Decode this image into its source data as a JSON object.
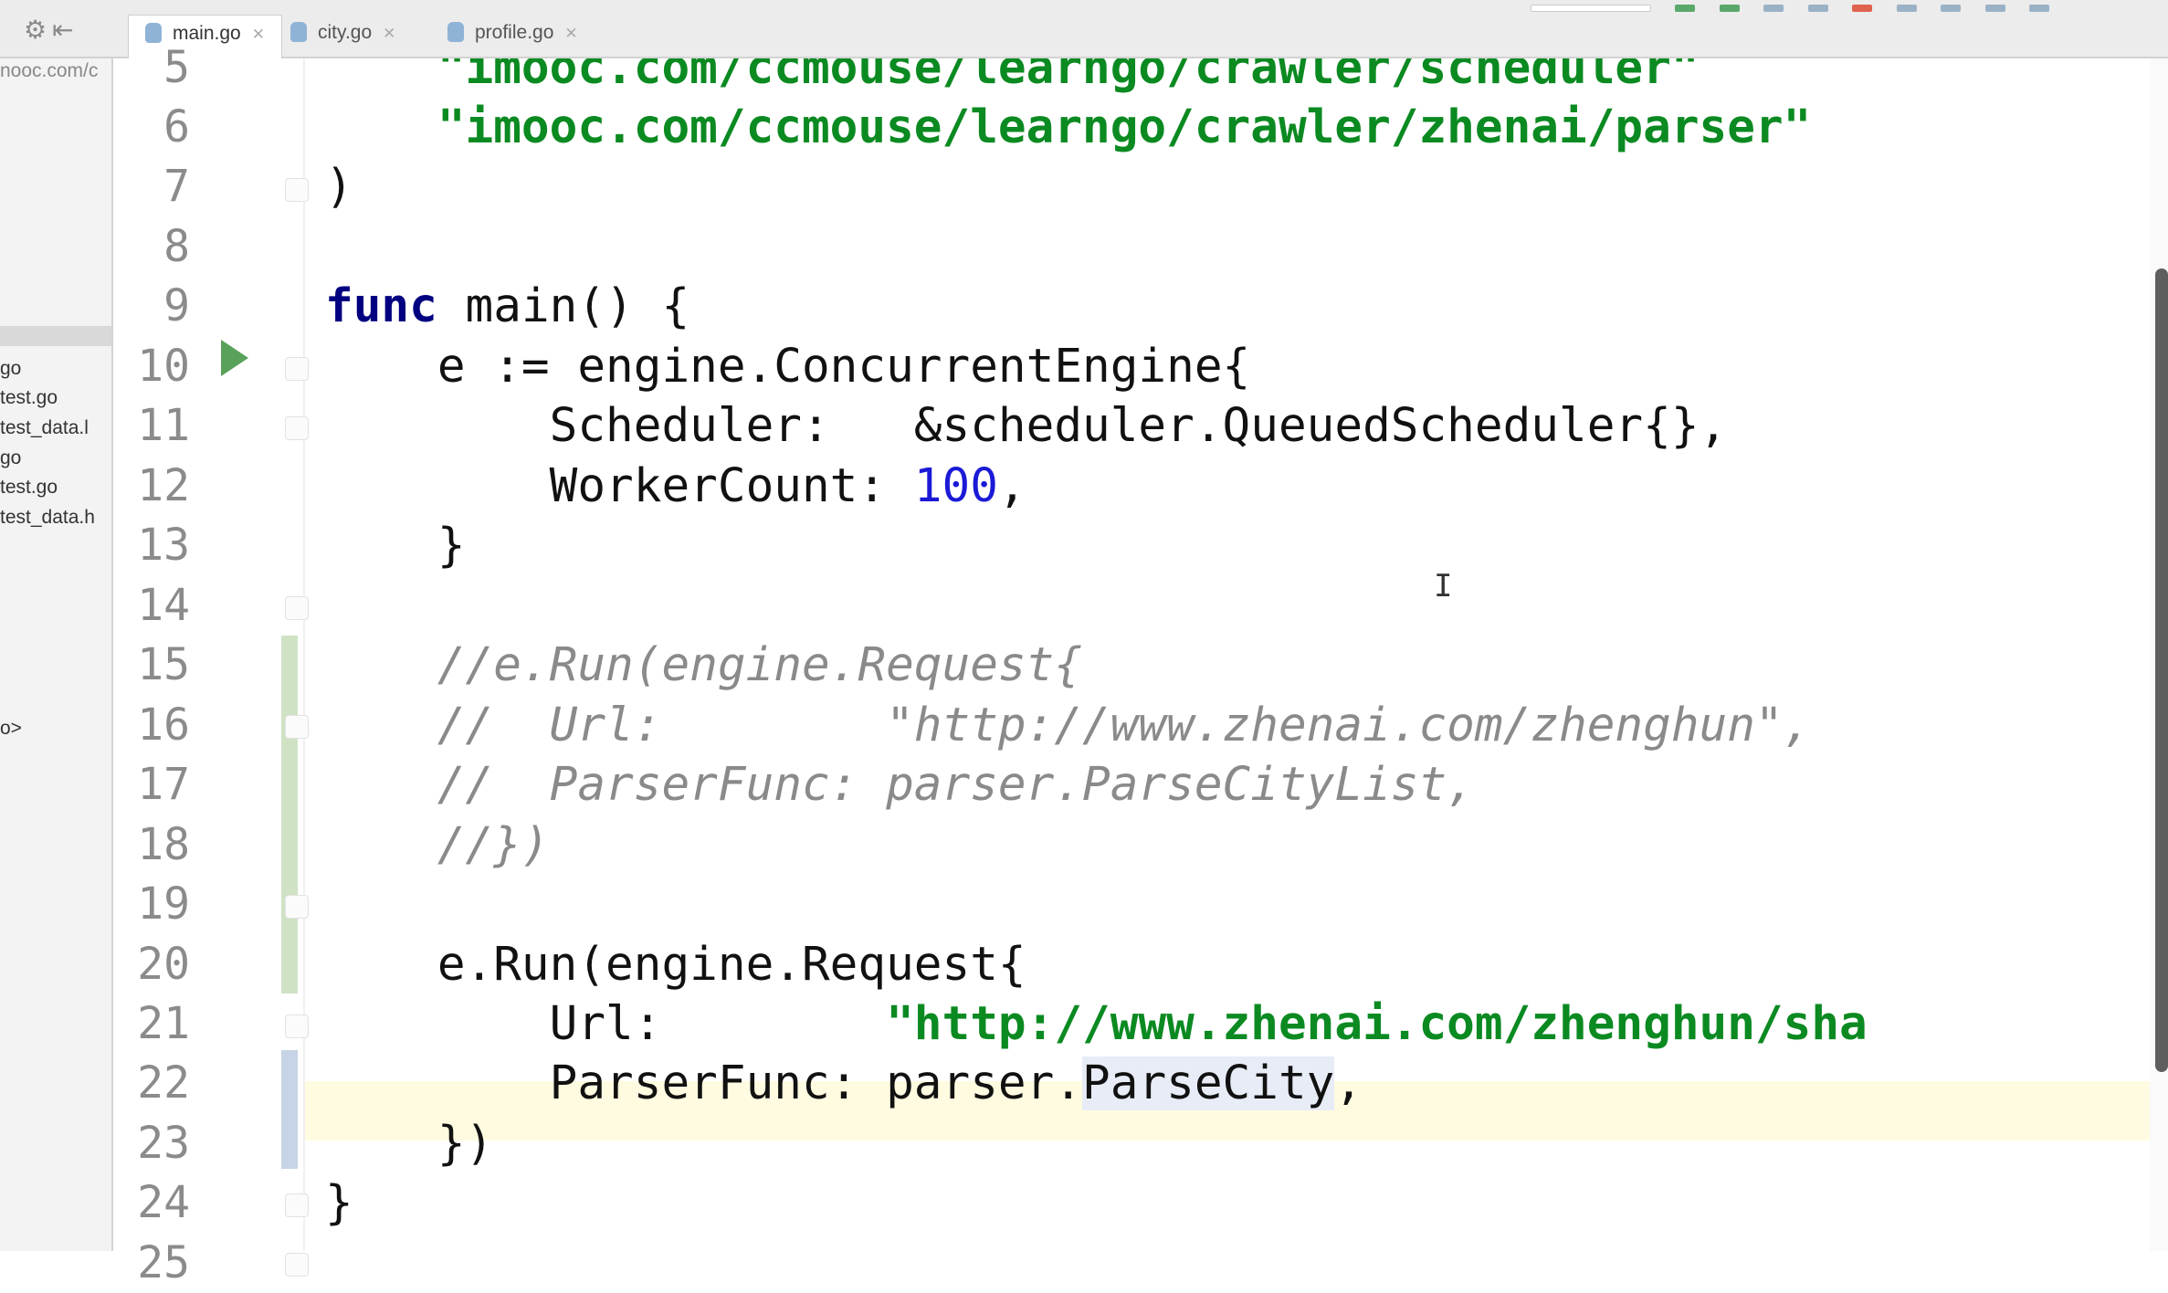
{
  "tabs": [
    {
      "label": "main.go",
      "active": true
    },
    {
      "label": "city.go",
      "active": false
    },
    {
      "label": "profile.go",
      "active": false
    }
  ],
  "sidebar": {
    "breadcrumb": "nooc.com/c",
    "files": [
      "go",
      "test.go",
      "test_data.l",
      "go",
      "test.go",
      "test_data.h",
      "o>"
    ]
  },
  "editor": {
    "current_line": 22,
    "lines": [
      {
        "n": "5",
        "text": "    \"imooc.com/ccmouse/learngo/crawler/scheduler\""
      },
      {
        "n": "6",
        "text": "    \"imooc.com/ccmouse/learngo/crawler/zhenai/parser\""
      },
      {
        "n": "7",
        "text": ")"
      },
      {
        "n": "8",
        "text": ""
      },
      {
        "n": "9",
        "text": "func main() {"
      },
      {
        "n": "10",
        "text": "    e := engine.ConcurrentEngine{"
      },
      {
        "n": "11",
        "text": "        Scheduler:   &scheduler.QueuedScheduler{},"
      },
      {
        "n": "12",
        "text": "        WorkerCount: 100,"
      },
      {
        "n": "13",
        "text": "    }"
      },
      {
        "n": "14",
        "text": ""
      },
      {
        "n": "15",
        "text": "    //e.Run(engine.Request{"
      },
      {
        "n": "16",
        "text": "    //  Url:        \"http://www.zhenai.com/zhenghun\","
      },
      {
        "n": "17",
        "text": "    //  ParserFunc: parser.ParseCityList,"
      },
      {
        "n": "18",
        "text": "    //})"
      },
      {
        "n": "19",
        "text": ""
      },
      {
        "n": "20",
        "text": "    e.Run(engine.Request{"
      },
      {
        "n": "21",
        "text": "        Url:        \"http://www.zhenai.com/zhenghun/sha"
      },
      {
        "n": "22",
        "text": "        ParserFunc: parser.ParseCity,"
      },
      {
        "n": "23",
        "text": "    })"
      },
      {
        "n": "24",
        "text": "}"
      },
      {
        "n": "25",
        "text": ""
      }
    ]
  },
  "syntax_colors": {
    "keyword": "#000080",
    "string": "#0b8a21",
    "number": "#1a1ad6",
    "comment": "#8a8a8a"
  },
  "icons": [
    "gear-icon",
    "collapse-icon",
    "run-gutter-icon",
    "go-file-icon",
    "close-tab-icon",
    "text-cursor-icon"
  ]
}
